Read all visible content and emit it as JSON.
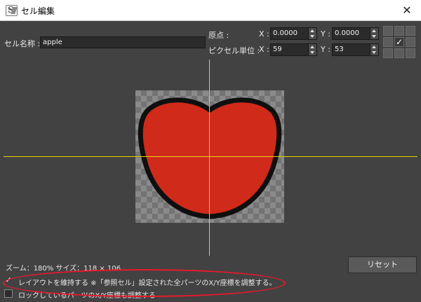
{
  "window": {
    "title": "セル編集",
    "close_glyph": "✕",
    "app_icon": "s-app-icon"
  },
  "form": {
    "cell_name_label": "セル名称 :",
    "cell_name_value": "apple",
    "origin_label": "原点 :",
    "pixel_unit_label": "ピクセル単位 :",
    "origin_x_label": "X :",
    "origin_x_value": "0.0000",
    "origin_y_label": "Y :",
    "origin_y_value": "0.0000",
    "pixel_x_label": "X :",
    "pixel_x_value": "59",
    "pixel_y_label": "Y :",
    "pixel_y_value": "53"
  },
  "anchor_grid": {
    "selected_index": 5,
    "check_glyph": "✓"
  },
  "canvas": {
    "fill_color": "#cf2a1a",
    "outline_color": "#0f0f0f",
    "guide_color": "#e6d300"
  },
  "status": {
    "text": "ズーム：180%   サイズ：118 × 106"
  },
  "buttons": {
    "reset": "リセット"
  },
  "options": {
    "keep_layout_label": "レイアウトを維持する ※「参照セル」設定された全パーツのX/Y座標を調整する。",
    "keep_layout_checked": true,
    "locked_parts_label": "ロックしているパーツのX/Y座標も調整する",
    "locked_parts_checked": false,
    "check_glyph": "✓"
  },
  "annotation": {
    "highlight_color": "#e8192c"
  }
}
